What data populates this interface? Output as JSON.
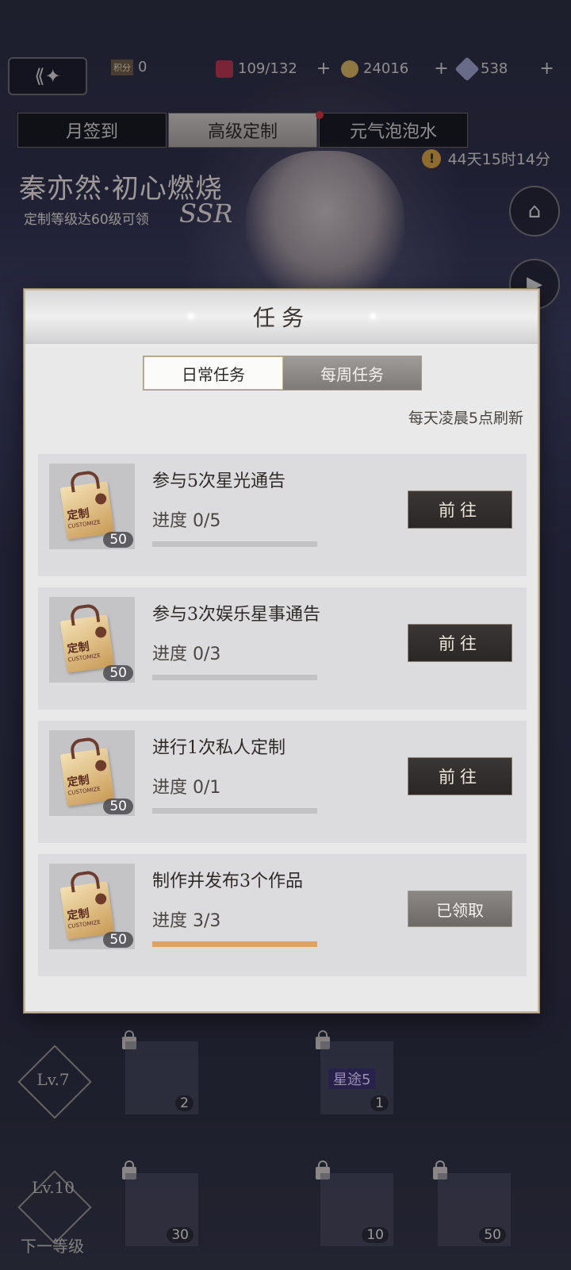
{
  "header": {
    "back_icon": "back-arrow-icon",
    "points_label": "积分",
    "points_value": "0",
    "stamina": "109/132",
    "coins": "24016",
    "diamonds": "538",
    "plus": "+"
  },
  "top_tabs": [
    {
      "label": "月签到"
    },
    {
      "label": "高级定制"
    },
    {
      "label": "元气泡泡水"
    }
  ],
  "countdown": {
    "warn": "!",
    "text": "44天15时14分"
  },
  "banner": {
    "title": "秦亦然·初心燃烧",
    "subtitle": "定制等级达60级可领",
    "rarity": "SSR"
  },
  "modal": {
    "title": "任务",
    "tabs": {
      "daily": "日常任务",
      "weekly": "每周任务"
    },
    "refresh_note": "每天凌晨5点刷新",
    "reward_label": "定制",
    "reward_sub": "CUSTOMIZE",
    "tasks": [
      {
        "name": "参与5次星光通告",
        "progress": "进度 0/5",
        "progress_fraction": 0,
        "qty": "50",
        "action": "前往"
      },
      {
        "name": "参与3次娱乐星事通告",
        "progress": "进度 0/3",
        "progress_fraction": 0,
        "qty": "50",
        "action": "前往"
      },
      {
        "name": "进行1次私人定制",
        "progress": "进度 0/1",
        "progress_fraction": 0,
        "qty": "50",
        "action": "前往"
      },
      {
        "name": "制作并发布3个作品",
        "progress": "进度 3/3",
        "progress_fraction": 1,
        "qty": "50",
        "action": "已领取"
      }
    ]
  },
  "bottom": {
    "row1": {
      "level": "Lv.7",
      "item1_count": "2",
      "item2_label": "星途5",
      "item2_count": "1"
    },
    "row2": {
      "level": "Lv.10",
      "next_label": "下一等级",
      "item1_count": "30",
      "item2_count": "10",
      "item3_count": "50"
    }
  },
  "colors": {
    "accent_gold": "#d8a566",
    "button_dark": "#2a2726",
    "modal_bg": "#e9e9ea"
  }
}
